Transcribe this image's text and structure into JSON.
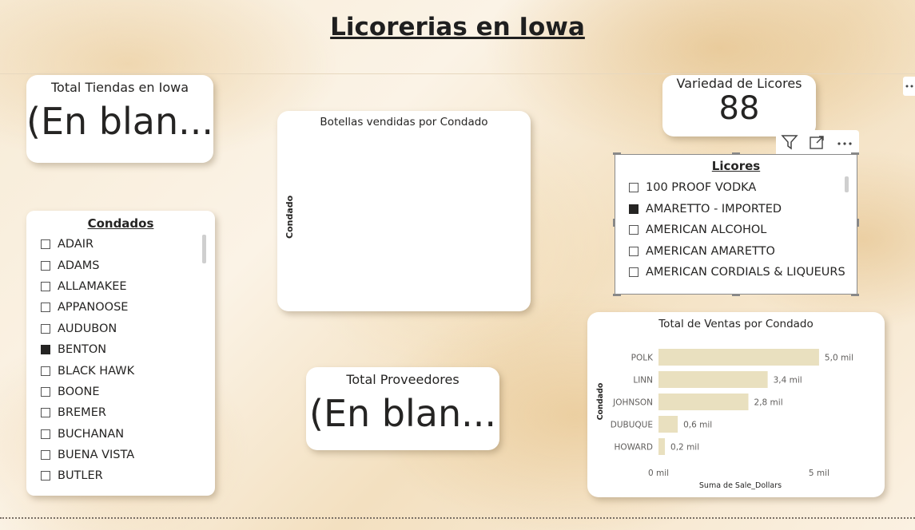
{
  "page_title": "Licorerias en Iowa",
  "kpi_tiendas": {
    "title": "Total Tiendas en Iowa",
    "value": "(En blan..."
  },
  "kpi_variedad": {
    "title": "Variedad de Licores",
    "value": "88"
  },
  "kpi_proveedores": {
    "title": "Total Proveedores",
    "value": "(En blan..."
  },
  "botellas_chart": {
    "title": "Botellas vendidas por Condado",
    "ylabel": "Condado"
  },
  "condados_slicer": {
    "header": "Condados",
    "items": [
      {
        "label": "ADAIR",
        "checked": false
      },
      {
        "label": "ADAMS",
        "checked": false
      },
      {
        "label": "ALLAMAKEE",
        "checked": false
      },
      {
        "label": "APPANOOSE",
        "checked": false
      },
      {
        "label": "AUDUBON",
        "checked": false
      },
      {
        "label": "BENTON",
        "checked": true
      },
      {
        "label": "BLACK HAWK",
        "checked": false
      },
      {
        "label": "BOONE",
        "checked": false
      },
      {
        "label": "BREMER",
        "checked": false
      },
      {
        "label": "BUCHANAN",
        "checked": false
      },
      {
        "label": "BUENA VISTA",
        "checked": false
      },
      {
        "label": "BUTLER",
        "checked": false
      }
    ]
  },
  "licores_slicer": {
    "header": "Licores",
    "items": [
      {
        "label": "100 PROOF VODKA",
        "checked": false
      },
      {
        "label": "AMARETTO - IMPORTED",
        "checked": true
      },
      {
        "label": "AMERICAN ALCOHOL",
        "checked": false
      },
      {
        "label": "AMERICAN AMARETTO",
        "checked": false
      },
      {
        "label": "AMERICAN CORDIALS & LIQUEURS",
        "checked": false
      }
    ]
  },
  "visual_header_icons": [
    "filter-icon",
    "focus-mode-icon",
    "more-options-icon"
  ],
  "page_more_icon": "more-options-icon",
  "chart_data": {
    "type": "bar",
    "orientation": "horizontal",
    "title": "Total de Ventas por Condado",
    "xlabel": "Suma de Sale_Dollars",
    "ylabel": "Condado",
    "categories": [
      "POLK",
      "LINN",
      "JOHNSON",
      "DUBUQUE",
      "HOWARD"
    ],
    "values": [
      5.0,
      3.4,
      2.8,
      0.6,
      0.2
    ],
    "data_labels": [
      "5,0 mil",
      "3,4 mil",
      "2,8 mil",
      "0,6 mil",
      "0,2 mil"
    ],
    "xticks": [
      0,
      5
    ],
    "xtick_labels": [
      "0 mil",
      "5 mil"
    ],
    "xlim": [
      0,
      5.4
    ],
    "bar_color": "#e9e0bf",
    "grid": false
  }
}
